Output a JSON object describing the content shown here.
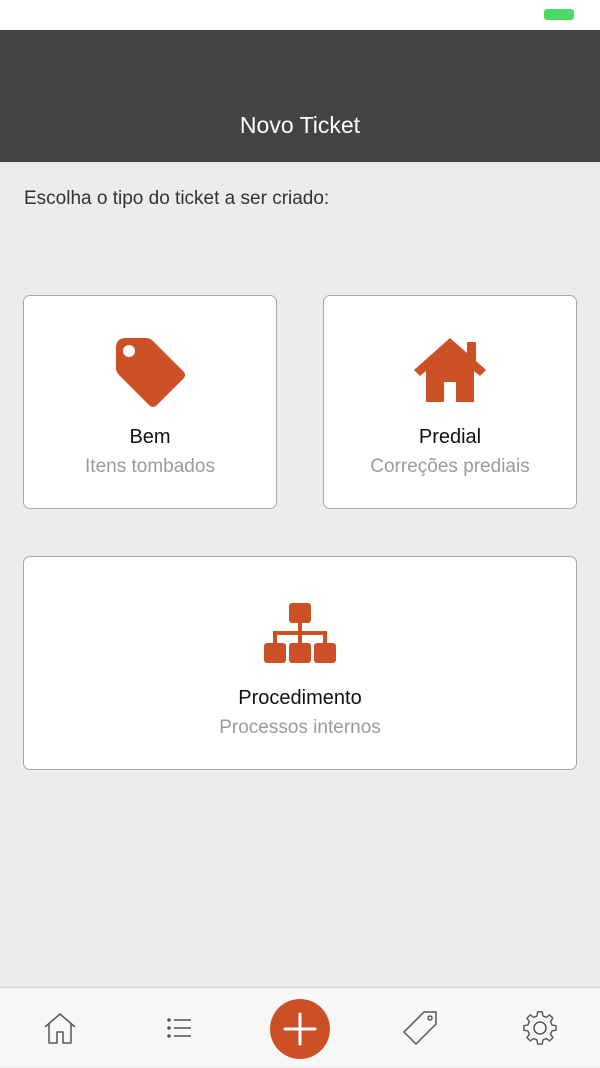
{
  "header": {
    "title": "Novo Ticket"
  },
  "prompt": "Escolha o tipo do ticket a ser criado:",
  "cards": [
    {
      "title": "Bem",
      "subtitle": "Itens tombados",
      "icon": "tag-icon"
    },
    {
      "title": "Predial",
      "subtitle": "Correções prediais",
      "icon": "house-icon"
    },
    {
      "title": "Procedimento",
      "subtitle": "Processos internos",
      "icon": "org-chart-icon"
    }
  ],
  "tab_bar": {
    "items": [
      "home-icon",
      "list-icon",
      "add-icon",
      "tag-outline-icon",
      "gear-icon"
    ]
  },
  "colors": {
    "accent": "#cc5026",
    "header": "#444242",
    "background": "#ececec",
    "battery": "#4cd964"
  }
}
